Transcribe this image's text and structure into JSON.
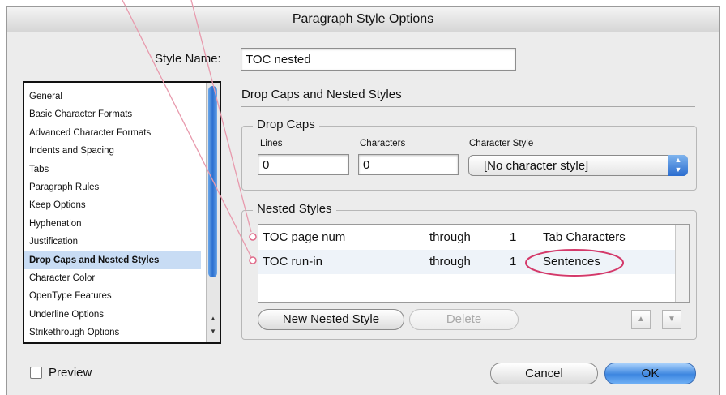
{
  "window": {
    "title": "Paragraph Style Options"
  },
  "style_name": {
    "label": "Style Name:",
    "value": "TOC nested"
  },
  "categories": [
    "General",
    "Basic Character Formats",
    "Advanced Character Formats",
    "Indents and Spacing",
    "Tabs",
    "Paragraph Rules",
    "Keep Options",
    "Hyphenation",
    "Justification",
    "Drop Caps and Nested Styles",
    "Character Color",
    "OpenType Features",
    "Underline Options",
    "Strikethrough Options"
  ],
  "selected_category": "Drop Caps and Nested Styles",
  "section_title": "Drop Caps and Nested Styles",
  "drop_caps": {
    "title": "Drop Caps",
    "lines_label": "Lines",
    "lines_value": "0",
    "characters_label": "Characters",
    "characters_value": "0",
    "char_style_label": "Character Style",
    "char_style_value": "[No character style]"
  },
  "nested_styles": {
    "title": "Nested Styles",
    "rows": [
      {
        "style": "TOC page num",
        "mode": "through",
        "count": "1",
        "unit": "Tab Characters"
      },
      {
        "style": "TOC run-in",
        "mode": "through",
        "count": "1",
        "unit": "Sentences"
      }
    ],
    "new_button": "New Nested Style",
    "delete_button": "Delete"
  },
  "preview_label": "Preview",
  "preview_checked": false,
  "cancel_button": "Cancel",
  "ok_button": "OK",
  "icons": {
    "move_up": "triangle-up-icon",
    "move_down": "triangle-down-icon"
  },
  "colors": {
    "annotation": "#d4396a",
    "selection": "#c8dcf4",
    "accent": "#2b6fd0"
  }
}
